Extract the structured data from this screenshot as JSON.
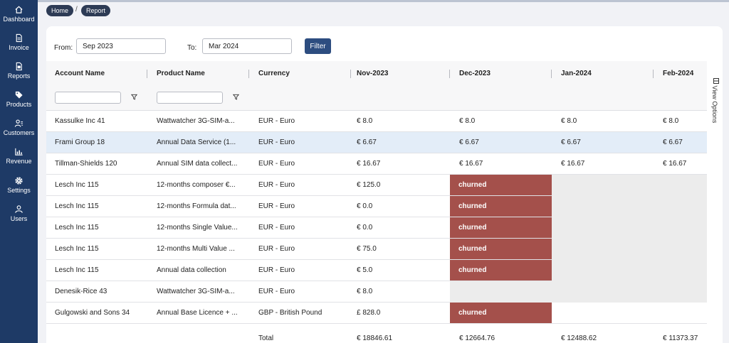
{
  "sidebar": {
    "items": [
      {
        "label": "Dashboard",
        "icon": "home-icon"
      },
      {
        "label": "Invoice",
        "icon": "document-icon"
      },
      {
        "label": "Reports",
        "icon": "report-icon"
      },
      {
        "label": "Products",
        "icon": "tag-icon"
      },
      {
        "label": "Customers",
        "icon": "users-icon"
      },
      {
        "label": "Revenue",
        "icon": "bar-chart-icon"
      },
      {
        "label": "Settings",
        "icon": "gear-icon"
      },
      {
        "label": "Users",
        "icon": "user-icon"
      }
    ]
  },
  "breadcrumb": {
    "home": "Home",
    "separator": "/",
    "current": "Report"
  },
  "filter": {
    "from_label": "From:",
    "from_value": "Sep 2023",
    "to_label": "To:",
    "to_value": "Mar 2024",
    "button": "Filter"
  },
  "view_options": "View Options",
  "columns": [
    "Account Name",
    "Product Name",
    "Currency",
    "Nov-2023",
    "Dec-2023",
    "Jan-2024",
    "Feb-2024"
  ],
  "rows": [
    {
      "account": "Kassulke Inc 41",
      "product": "Wattwatcher 3G-SIM-a...",
      "currency": "EUR - Euro",
      "nov": "€ 8.0",
      "dec": "€ 8.0",
      "jan": "€ 8.0",
      "feb": "€ 8.0"
    },
    {
      "account": "Frami Group 18",
      "product": "Annual Data Service (1...",
      "currency": "EUR - Euro",
      "nov": "€ 6.67",
      "dec": "€ 6.67",
      "jan": "€ 6.67",
      "feb": "€ 6.67"
    },
    {
      "account": "Tillman-Shields 120",
      "product": "Annual SIM data collect...",
      "currency": "EUR - Euro",
      "nov": "€ 16.67",
      "dec": "€ 16.67",
      "jan": "€ 16.67",
      "feb": "€ 16.67"
    },
    {
      "account": "Lesch Inc 115",
      "product": "12-months composer €...",
      "currency": "EUR - Euro",
      "nov": "€ 125.0",
      "dec": "churned"
    },
    {
      "account": "Lesch Inc 115",
      "product": "12-months Formula dat...",
      "currency": "EUR - Euro",
      "nov": "€ 0.0",
      "dec": "churned"
    },
    {
      "account": "Lesch Inc 115",
      "product": "12-months Single Value...",
      "currency": "EUR - Euro",
      "nov": "€ 0.0",
      "dec": "churned"
    },
    {
      "account": "Lesch Inc 115",
      "product": "12-months Multi Value ...",
      "currency": "EUR - Euro",
      "nov": "€ 75.0",
      "dec": "churned"
    },
    {
      "account": "Lesch Inc 115",
      "product": "Annual data collection",
      "currency": "EUR - Euro",
      "nov": "€ 5.0",
      "dec": "churned"
    },
    {
      "account": "Denesik-Rice 43",
      "product": "Wattwatcher 3G-SIM-a...",
      "currency": "EUR - Euro",
      "nov": "€ 8.0"
    },
    {
      "account": "Gulgowski and Sons 34",
      "product": "Annual Base Licence + ...",
      "currency": "GBP - British Pound",
      "nov": "£ 828.0",
      "dec": "churned"
    }
  ],
  "totals": {
    "label": "Total",
    "nov": "€ 18846.61",
    "dec": "€ 12664.76",
    "jan": "€ 12488.62",
    "feb": "€ 11373.37"
  }
}
